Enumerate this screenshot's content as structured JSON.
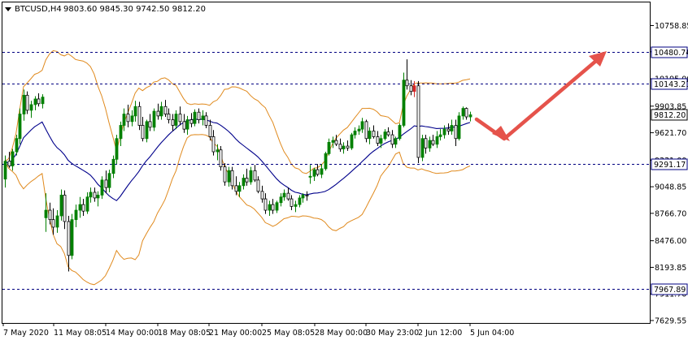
{
  "header": {
    "symbol": "BTCUSD,H4",
    "ohlc": "9803.60 9845.30 9742.50 9812.20"
  },
  "chart_data": {
    "type": "candlestick",
    "symbol": "BTCUSD",
    "timeframe": "H4",
    "ohlc_text": "9803.60 9845.30 9742.50 9812.20",
    "ylim": [
      7629.55,
      10950
    ],
    "y_ticks": [
      "10758.85",
      "10480.70",
      "10195.00",
      "9903.85",
      "9621.70",
      "9331.00",
      "9048.85",
      "8766.70",
      "8476.00",
      "8193.85",
      "7911.70",
      "7629.55"
    ],
    "x_ticks": [
      "7 May 2020",
      "11 May 08:05",
      "14 May 00:00",
      "18 May 08:05",
      "21 May 00:00",
      "25 May 08:05",
      "28 May 00:00",
      "30 May 23:00",
      "2 Jun 12:00",
      "5 Jun 04:00"
    ],
    "levels": [
      {
        "value": 10480.74,
        "label": "10480.74",
        "color": "#000080"
      },
      {
        "value": 10143.21,
        "label": "10143.21",
        "color": "#000080"
      },
      {
        "value": 9291.17,
        "label": "9291.17",
        "color": "#000080"
      },
      {
        "value": 7967.89,
        "label": "7967.89",
        "color": "#000080"
      }
    ],
    "current_price": {
      "value": 9812.2,
      "label": "9812.20"
    },
    "candles": [
      [
        9130,
        9380,
        9040,
        9320
      ],
      [
        9320,
        9420,
        9250,
        9270
      ],
      [
        9270,
        9450,
        9220,
        9420
      ],
      [
        9420,
        9600,
        9380,
        9560
      ],
      [
        9560,
        9880,
        9500,
        9820
      ],
      [
        9820,
        10080,
        9750,
        10020
      ],
      [
        10020,
        10060,
        9820,
        9860
      ],
      [
        9860,
        9960,
        9780,
        9920
      ],
      [
        9920,
        10010,
        9860,
        9980
      ],
      [
        9980,
        10040,
        9900,
        9930
      ],
      [
        9930,
        10030,
        9880,
        10000
      ],
      [
        8720,
        8980,
        8570,
        8800
      ],
      [
        8800,
        8880,
        8650,
        8700
      ],
      [
        8700,
        8820,
        8540,
        8620
      ],
      [
        8620,
        8800,
        8560,
        8740
      ],
      [
        8740,
        9020,
        8690,
        8960
      ],
      [
        8960,
        9010,
        8600,
        8680
      ],
      [
        8680,
        8740,
        8150,
        8320
      ],
      [
        8320,
        8760,
        8280,
        8700
      ],
      [
        8700,
        8860,
        8620,
        8800
      ],
      [
        8800,
        8940,
        8720,
        8860
      ],
      [
        8860,
        8920,
        8740,
        8790
      ],
      [
        8790,
        8990,
        8760,
        8940
      ],
      [
        8940,
        9040,
        8880,
        8990
      ],
      [
        8990,
        9040,
        8890,
        8930
      ],
      [
        8930,
        9000,
        8840,
        8960
      ],
      [
        8960,
        9160,
        8920,
        9120
      ],
      [
        9120,
        9220,
        8980,
        9040
      ],
      [
        9040,
        9230,
        8990,
        9190
      ],
      [
        9190,
        9380,
        9140,
        9340
      ],
      [
        9340,
        9600,
        9290,
        9560
      ],
      [
        9560,
        9740,
        9480,
        9700
      ],
      [
        9700,
        9880,
        9640,
        9820
      ],
      [
        9820,
        9920,
        9680,
        9740
      ],
      [
        9740,
        9860,
        9690,
        9800
      ],
      [
        9800,
        9960,
        9740,
        9900
      ],
      [
        9900,
        9950,
        9650,
        9700
      ],
      [
        9700,
        9790,
        9530,
        9560
      ],
      [
        9560,
        9760,
        9520,
        9740
      ],
      [
        9740,
        9820,
        9640,
        9680
      ],
      [
        9680,
        9880,
        9640,
        9850
      ],
      [
        9850,
        9930,
        9760,
        9800
      ],
      [
        9800,
        9950,
        9760,
        9900
      ],
      [
        9900,
        9970,
        9790,
        9820
      ],
      [
        9820,
        9880,
        9720,
        9760
      ],
      [
        9760,
        9820,
        9640,
        9700
      ],
      [
        9700,
        9860,
        9660,
        9820
      ],
      [
        9820,
        9900,
        9700,
        9740
      ],
      [
        9740,
        9820,
        9620,
        9660
      ],
      [
        9660,
        9800,
        9600,
        9760
      ],
      [
        9760,
        9830,
        9680,
        9720
      ],
      [
        9720,
        9870,
        9690,
        9840
      ],
      [
        9840,
        9880,
        9720,
        9760
      ],
      [
        9760,
        9860,
        9700,
        9800
      ],
      [
        9800,
        9840,
        9670,
        9700
      ],
      [
        9700,
        9760,
        9540,
        9580
      ],
      [
        9580,
        9650,
        9380,
        9420
      ],
      [
        9420,
        9500,
        9330,
        9440
      ],
      [
        9440,
        9480,
        9220,
        9260
      ],
      [
        9260,
        9300,
        9060,
        9100
      ],
      [
        9100,
        9260,
        9050,
        9220
      ],
      [
        9220,
        9260,
        9020,
        9060
      ],
      [
        9060,
        9160,
        8960,
        9000
      ],
      [
        9000,
        9100,
        8940,
        9060
      ],
      [
        9060,
        9180,
        9020,
        9140
      ],
      [
        9140,
        9240,
        9060,
        9100
      ],
      [
        9100,
        9260,
        9070,
        9220
      ],
      [
        9220,
        9280,
        9100,
        9120
      ],
      [
        9120,
        9160,
        8980,
        9000
      ],
      [
        9000,
        9060,
        8880,
        8920
      ],
      [
        8920,
        8980,
        8760,
        8800
      ],
      [
        8800,
        8900,
        8740,
        8860
      ],
      [
        8860,
        8920,
        8760,
        8800
      ],
      [
        8800,
        8900,
        8770,
        8880
      ],
      [
        8880,
        8980,
        8840,
        8940
      ],
      [
        8940,
        9020,
        8900,
        8980
      ],
      [
        8980,
        9040,
        8900,
        8920
      ],
      [
        8920,
        8960,
        8800,
        8840
      ],
      [
        8840,
        8900,
        8780,
        8860
      ],
      [
        8860,
        8960,
        8830,
        8930
      ],
      [
        8930,
        8980,
        8880,
        8960
      ],
      [
        8960,
        9000,
        8900,
        8950
      ],
      [
        9150,
        9280,
        9080,
        9160
      ],
      [
        9160,
        9250,
        9110,
        9230
      ],
      [
        9230,
        9290,
        9160,
        9180
      ],
      [
        9180,
        9290,
        9140,
        9240
      ],
      [
        9240,
        9420,
        9220,
        9400
      ],
      [
        9400,
        9560,
        9380,
        9520
      ],
      [
        9520,
        9580,
        9460,
        9540
      ],
      [
        9540,
        9600,
        9480,
        9500
      ],
      [
        9500,
        9560,
        9420,
        9450
      ],
      [
        9450,
        9520,
        9400,
        9480
      ],
      [
        9480,
        9540,
        9430,
        9460
      ],
      [
        9460,
        9620,
        9440,
        9600
      ],
      [
        9600,
        9680,
        9560,
        9640
      ],
      [
        9640,
        9700,
        9600,
        9660
      ],
      [
        9660,
        9780,
        9620,
        9740
      ],
      [
        9740,
        9760,
        9520,
        9560
      ],
      [
        9560,
        9680,
        9500,
        9640
      ],
      [
        9640,
        9700,
        9560,
        9580
      ],
      [
        9580,
        9640,
        9480,
        9510
      ],
      [
        9510,
        9600,
        9460,
        9560
      ],
      [
        9560,
        9660,
        9540,
        9630
      ],
      [
        9630,
        9680,
        9580,
        9600
      ],
      [
        9600,
        9650,
        9460,
        9500
      ],
      [
        9500,
        9580,
        9460,
        9560
      ],
      [
        9560,
        9720,
        9540,
        9700
      ],
      [
        9700,
        10260,
        9680,
        10180
      ],
      [
        10180,
        10400,
        10080,
        10120
      ],
      [
        10120,
        10180,
        10020,
        10060
      ],
      [
        10060,
        10170,
        10000,
        10120
      ],
      [
        10120,
        10170,
        9300,
        9360
      ],
      [
        9360,
        9600,
        9320,
        9560
      ],
      [
        9560,
        9600,
        9400,
        9460
      ],
      [
        9460,
        9580,
        9420,
        9540
      ],
      [
        9540,
        9600,
        9480,
        9500
      ],
      [
        9500,
        9640,
        9460,
        9580
      ],
      [
        9580,
        9660,
        9540,
        9600
      ],
      [
        9600,
        9700,
        9560,
        9660
      ],
      [
        9660,
        9720,
        9600,
        9640
      ],
      [
        9640,
        9760,
        9600,
        9700
      ],
      [
        9700,
        9760,
        9480,
        9560
      ],
      [
        9560,
        9840,
        9540,
        9800
      ],
      [
        9800,
        9900,
        9760,
        9880
      ],
      [
        9880,
        9890,
        9760,
        9790
      ],
      [
        9790,
        9845,
        9742,
        9812
      ]
    ]
  }
}
